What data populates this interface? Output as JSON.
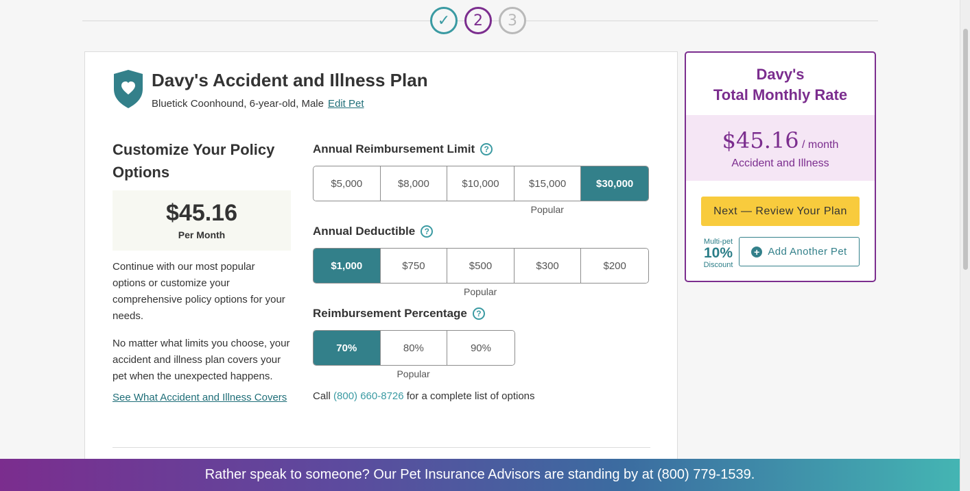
{
  "progress": {
    "steps": [
      {
        "label": "✓",
        "state": "done"
      },
      {
        "label": "2",
        "state": "current"
      },
      {
        "label": "3",
        "state": "todo"
      }
    ]
  },
  "plan": {
    "title": "Davy's Accident and Illness Plan",
    "pet_details": "Bluetick Coonhound, 6-year-old, Male",
    "edit_link": "Edit Pet"
  },
  "customize": {
    "heading": "Customize Your Policy Options",
    "price": "$45.16",
    "price_period": "Per Month",
    "paragraph1": "Continue with our most popular options or customize your comprehensive policy options for your needs.",
    "paragraph2": "No matter what limits you choose, your accident and illness plan covers your pet when the unexpected happens.",
    "covers_link": "See What Accident and Illness Covers"
  },
  "options": {
    "limit": {
      "label": "Annual Reimbursement Limit",
      "choices": [
        "$5,000",
        "$8,000",
        "$10,000",
        "$15,000",
        "$30,000"
      ],
      "selected": 4,
      "popular_index": 3,
      "popular_label": "Popular"
    },
    "deductible": {
      "label": "Annual Deductible",
      "choices": [
        "$1,000",
        "$750",
        "$500",
        "$300",
        "$200"
      ],
      "selected": 0,
      "popular_index": 2,
      "popular_label": "Popular"
    },
    "percentage": {
      "label": "Reimbursement Percentage",
      "choices": [
        "70%",
        "80%",
        "90%"
      ],
      "selected": 0,
      "popular_index": 1,
      "popular_label": "Popular"
    },
    "help_icon": "?",
    "call_prefix": "Call",
    "call_phone": "(800) 660-8726",
    "call_suffix": "for a complete list of options"
  },
  "summary": {
    "title_line1": "Davy's",
    "title_line2": "Total Monthly Rate",
    "amount": "$45.16",
    "per": "/ month",
    "coverage": "Accident and Illness",
    "next_button": "Next — Review Your Plan",
    "multi_top": "Multi-pet",
    "multi_pct": "10%",
    "multi_bottom": "Discount",
    "add_pet_button": "Add Another Pet"
  },
  "banner": {
    "text": "Rather speak to someone? Our Pet Insurance Advisors are standing by at (800) 779-1539."
  },
  "colors": {
    "teal": "#33808a",
    "purple": "#7b2d8e",
    "yellow": "#f8cb3d"
  }
}
